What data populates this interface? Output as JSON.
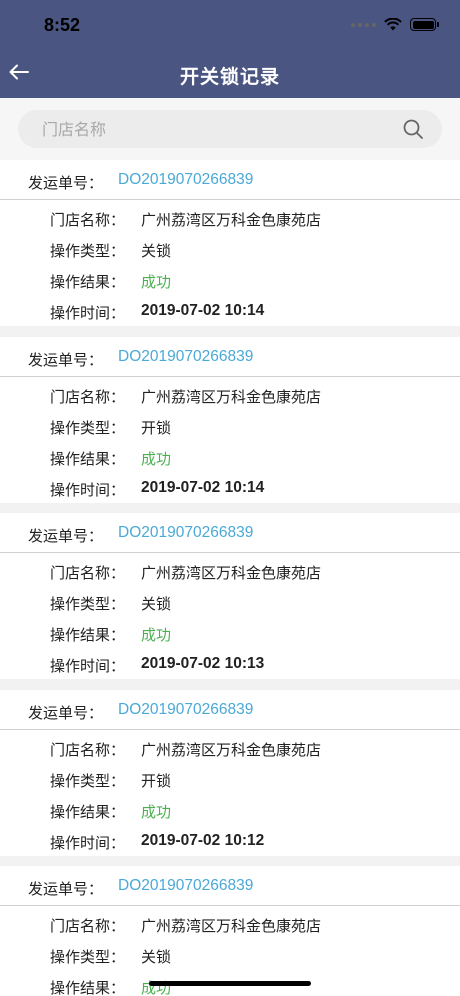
{
  "status_bar": {
    "time": "8:52"
  },
  "nav": {
    "title": "开关锁记录"
  },
  "search": {
    "placeholder": "门店名称"
  },
  "labels": {
    "shipment_no": "发运单号：",
    "store_name": "门店名称：",
    "op_type": "操作类型：",
    "op_result": "操作结果：",
    "op_time": "操作时间："
  },
  "colors": {
    "header_bg": "#4a5581",
    "link": "#4aa9d8",
    "success": "#4caf50"
  },
  "records": [
    {
      "shipment_no": "DO2019070266839",
      "store_name": "广州荔湾区万科金色康苑店",
      "op_type": "关锁",
      "op_result": "成功",
      "op_time": "2019-07-02 10:14"
    },
    {
      "shipment_no": "DO2019070266839",
      "store_name": "广州荔湾区万科金色康苑店",
      "op_type": "开锁",
      "op_result": "成功",
      "op_time": "2019-07-02 10:14"
    },
    {
      "shipment_no": "DO2019070266839",
      "store_name": "广州荔湾区万科金色康苑店",
      "op_type": "关锁",
      "op_result": "成功",
      "op_time": "2019-07-02 10:13"
    },
    {
      "shipment_no": "DO2019070266839",
      "store_name": "广州荔湾区万科金色康苑店",
      "op_type": "开锁",
      "op_result": "成功",
      "op_time": "2019-07-02 10:12"
    },
    {
      "shipment_no": "DO2019070266839",
      "store_name": "广州荔湾区万科金色康苑店",
      "op_type": "关锁",
      "op_result": "成功",
      "op_time": ""
    }
  ]
}
